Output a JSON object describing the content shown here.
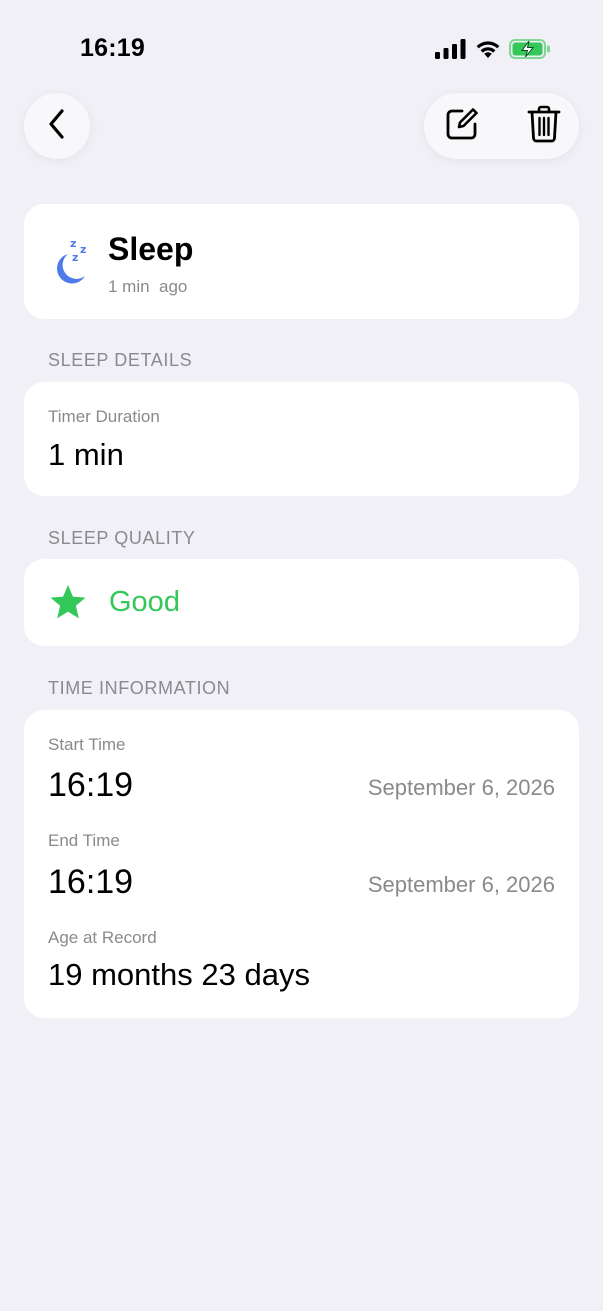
{
  "status_bar": {
    "time": "16:19",
    "icons": [
      "cellular-signal-icon",
      "wifi-icon",
      "battery-charging-icon"
    ],
    "battery_color": "#34C759"
  },
  "nav": {
    "back_icon": "chevron-left-icon",
    "edit_icon": "edit-square-pencil-icon",
    "delete_icon": "trash-icon"
  },
  "entry": {
    "icon": "sleep-moon-zzz-icon",
    "icon_color": "#4F7BEA",
    "title": "Sleep",
    "subtitle": "1 min  ago"
  },
  "sleep_details": {
    "header": "SLEEP DETAILS",
    "timer_label": "Timer Duration",
    "timer_value": "1 min"
  },
  "sleep_quality": {
    "header": "SLEEP QUALITY",
    "icon": "star-icon",
    "value": "Good",
    "color": "#34C759"
  },
  "time_information": {
    "header": "TIME INFORMATION",
    "start_label": "Start Time",
    "start_time": "16:19",
    "start_date": "September 6, 2026",
    "end_label": "End Time",
    "end_time": "16:19",
    "end_date": "September 6, 2026",
    "age_label": "Age at Record",
    "age_value": "19 months 23 days"
  },
  "colors": {
    "background": "#F0F0F6",
    "card": "#FFFFFF",
    "secondary_text": "#8A8A8E",
    "accent_green": "#34C759"
  }
}
